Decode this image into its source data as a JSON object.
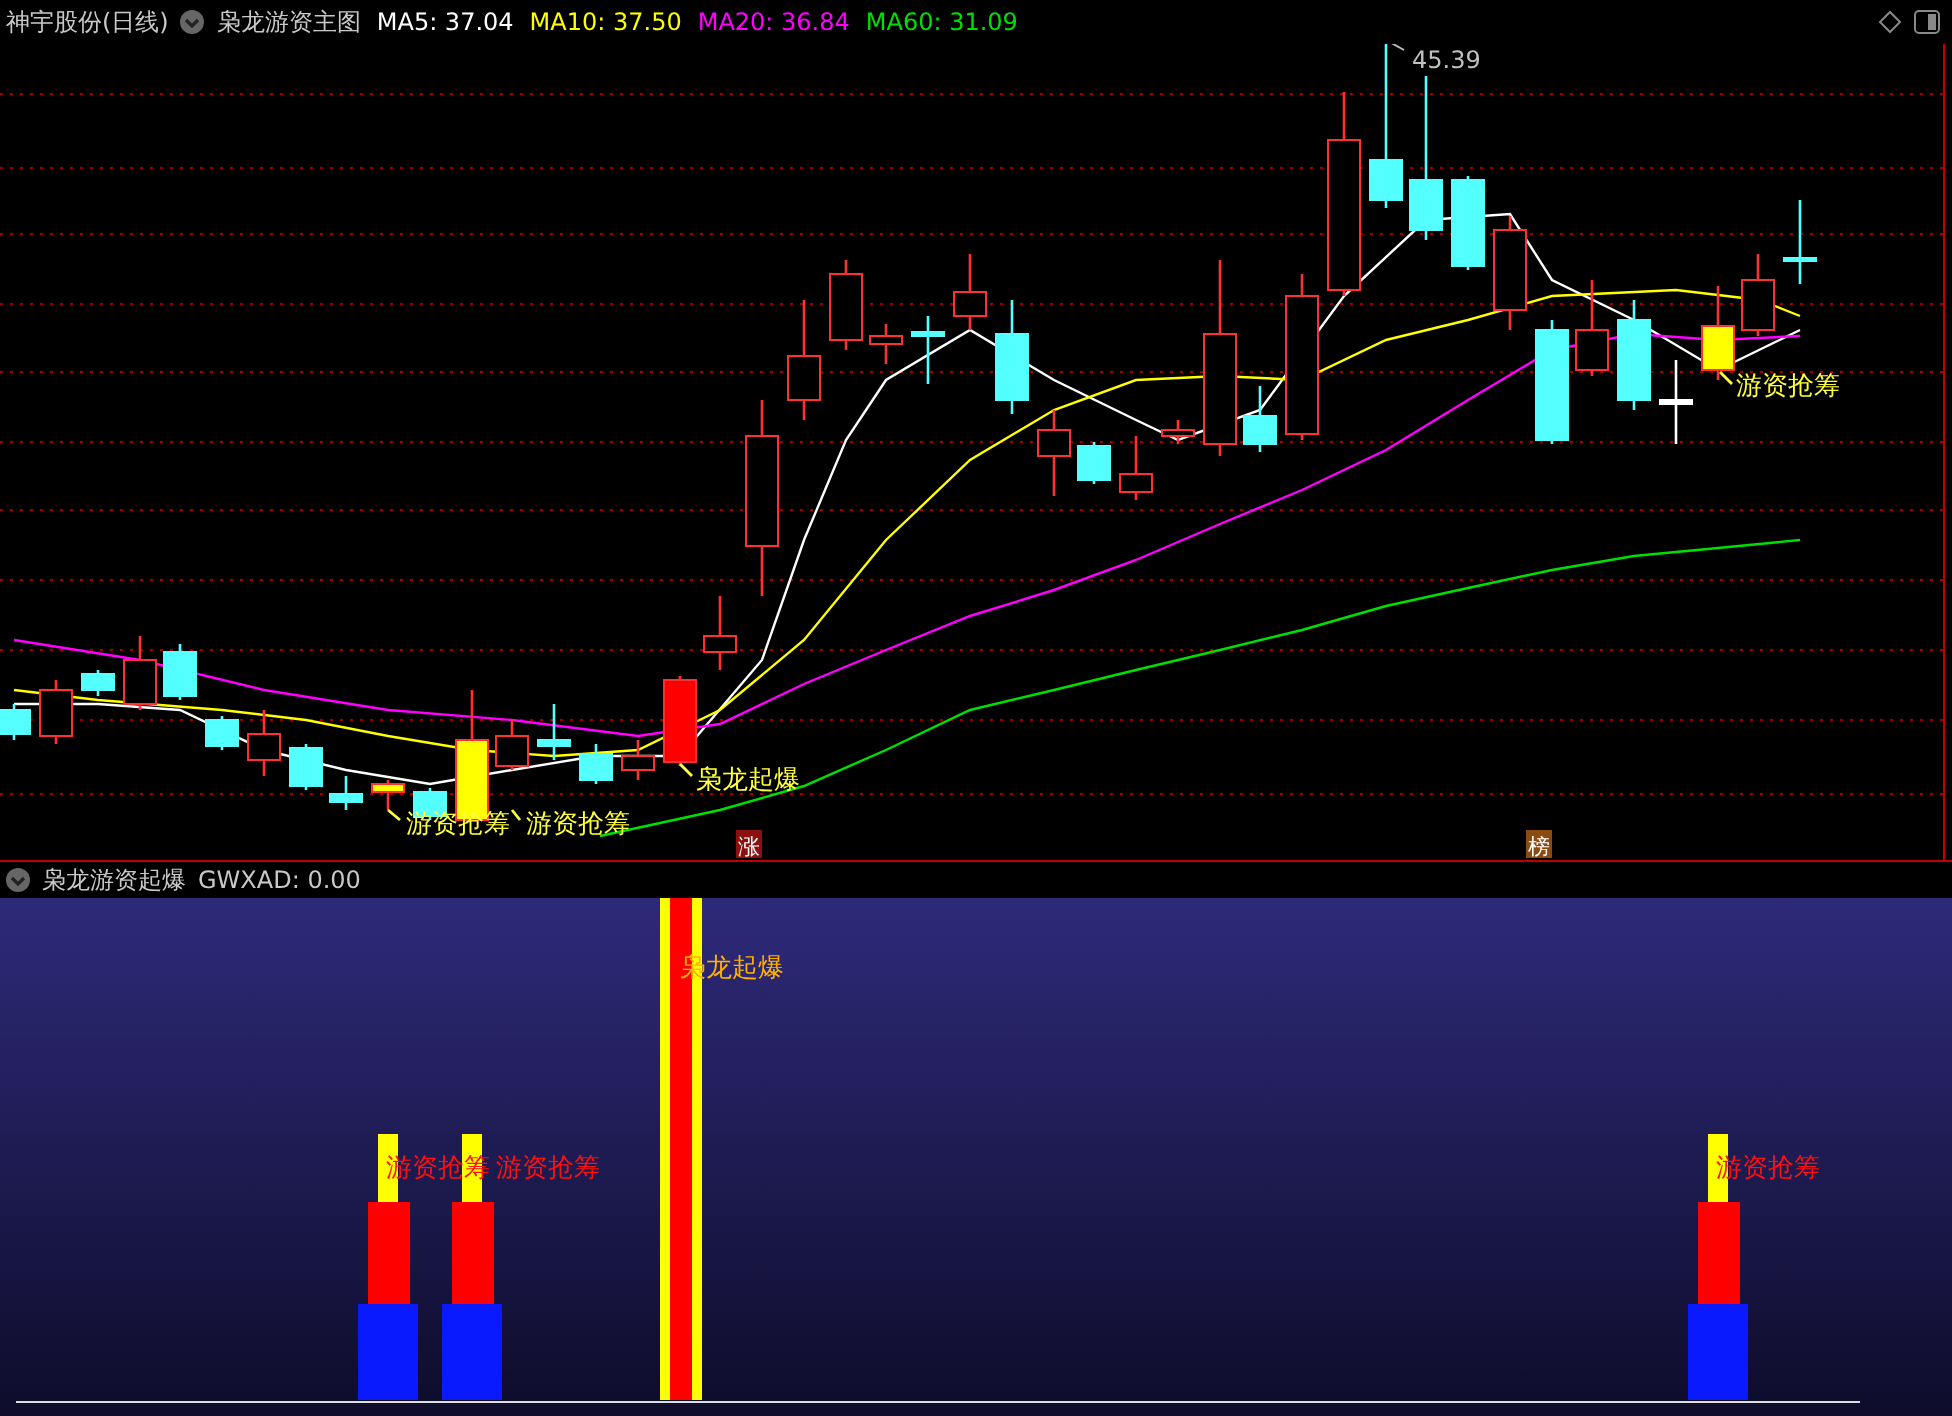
{
  "header": {
    "stock": "神宇股份(日线)",
    "indicator": "枭龙游资主图",
    "ma": [
      {
        "label": "MA5: 37.04",
        "color": "#ffffff"
      },
      {
        "label": "MA10: 37.50",
        "color": "#ffff00"
      },
      {
        "label": "MA20: 36.84",
        "color": "#ff00ff"
      },
      {
        "label": "MA60: 31.09",
        "color": "#00e000"
      }
    ]
  },
  "main_chart": {
    "high_label": "45.39",
    "signals": [
      {
        "text": "枭龙起爆"
      },
      {
        "text": "游资抢筹"
      },
      {
        "text": "游资抢筹"
      },
      {
        "text": "游资抢筹"
      }
    ],
    "badges": [
      {
        "text": "涨",
        "color": "#8b1010"
      },
      {
        "text": "榜",
        "color": "#8b4a10"
      }
    ]
  },
  "sub_panel": {
    "title": "枭龙游资起爆",
    "readout": "GWXAD: 0.00",
    "labels": [
      {
        "kind": "launch",
        "text": "枭龙起爆"
      },
      {
        "kind": "accumulate",
        "text": "游资抢筹"
      },
      {
        "kind": "accumulate",
        "text": "游资抢筹"
      },
      {
        "kind": "accumulate",
        "text": "游资抢筹"
      }
    ]
  }
}
